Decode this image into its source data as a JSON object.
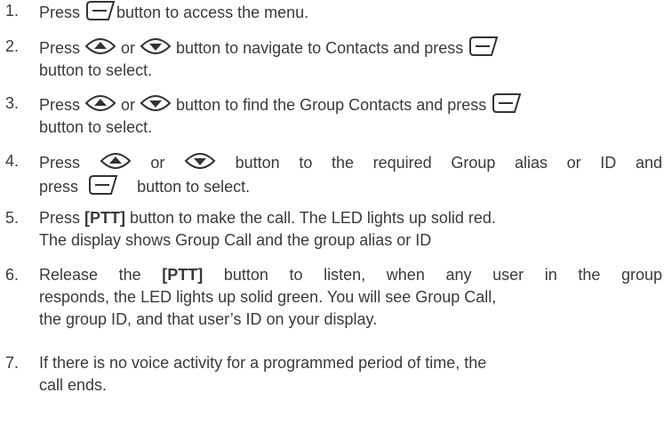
{
  "steps": [
    {
      "number": "1.",
      "lines": [
        [
          "Press ",
          "button to access the menu."
        ]
      ]
    },
    {
      "number": "2.",
      "lines": [
        [
          "Press ",
          " or ",
          " button to navigate to Contacts and press "
        ],
        [
          "button to select."
        ]
      ]
    },
    {
      "number": "3.",
      "lines": [
        [
          "Press ",
          " or ",
          " button to find the Group Contacts and press "
        ],
        [
          "button to select."
        ]
      ]
    },
    {
      "number": "4.",
      "lines": [
        [
          "Press ",
          " or ",
          " button to the required Group alias or ID and"
        ],
        [
          "press ",
          " button to select."
        ]
      ]
    },
    {
      "number": "5.",
      "lines": [
        [
          "Press ",
          "[PTT]",
          " button to make the call. The LED lights up solid red."
        ],
        [
          "The display shows Group Call  and the group alias or ID"
        ]
      ]
    },
    {
      "number": "6.",
      "lines": [
        [
          "Release the ",
          "[PTT]",
          " button to listen, when any user in the group"
        ],
        [
          "responds, the LED lights up solid green. You will see Group Call,"
        ],
        [
          "the group ID, and that user’s ID on your display."
        ]
      ]
    },
    {
      "number": "7.",
      "lines": [
        [
          "If there is no voice activity for a programmed period of time, the"
        ],
        [
          "call ends."
        ]
      ]
    }
  ],
  "icons": {
    "menu": "menu-key-icon",
    "up": "nav-up-icon",
    "down": "nav-down-icon"
  },
  "colors": {
    "text": "#3a3a3a",
    "icon_stroke": "#333333"
  }
}
